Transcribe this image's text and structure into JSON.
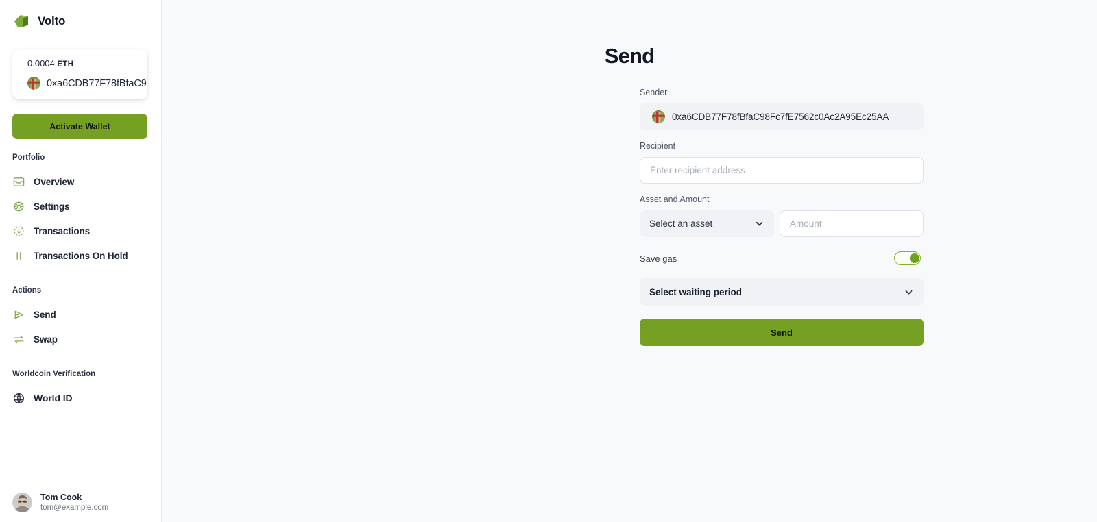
{
  "brand": {
    "name": "Volto",
    "logo_icon": "volto-leaf-logo",
    "accent": "#76a024"
  },
  "wallet": {
    "balance": "0.0004",
    "symbol": "ETH",
    "address_short": "0xa6CDB77F78fBfaC9",
    "identicon": "wallet-identicon",
    "activate_label": "Activate Wallet"
  },
  "sidebar": {
    "sections": [
      {
        "heading": "Portfolio",
        "items": [
          {
            "label": "Overview",
            "icon": "inbox-icon"
          },
          {
            "label": "Settings",
            "icon": "gear-icon"
          },
          {
            "label": "Transactions",
            "icon": "dotted-circle-arrow-icon"
          },
          {
            "label": "Transactions On Hold",
            "icon": "pause-icon"
          }
        ]
      },
      {
        "heading": "Actions",
        "items": [
          {
            "label": "Send",
            "icon": "send-triangle-icon"
          },
          {
            "label": "Swap",
            "icon": "swap-arrows-icon"
          }
        ]
      },
      {
        "heading": "Worldcoin Verification",
        "items": [
          {
            "label": "World ID",
            "icon": "globe-icon"
          }
        ]
      }
    ]
  },
  "user": {
    "name": "Tom Cook",
    "email": "tom@example.com",
    "avatar": "user-avatar"
  },
  "main": {
    "title": "Send",
    "sender": {
      "label": "Sender",
      "address": "0xa6CDB77F78fBfaC98Fc7fE7562c0Ac2A95Ec25AA",
      "identicon": "sender-identicon"
    },
    "recipient": {
      "label": "Recipient",
      "placeholder": "Enter recipient address",
      "value": ""
    },
    "asset_amount": {
      "label": "Asset and Amount",
      "asset_selected": "Select an asset",
      "amount_placeholder": "Amount",
      "amount_value": ""
    },
    "save_gas": {
      "label": "Save gas",
      "enabled": true
    },
    "waiting_period": {
      "selected": "Select waiting period"
    },
    "submit_label": "Send"
  }
}
